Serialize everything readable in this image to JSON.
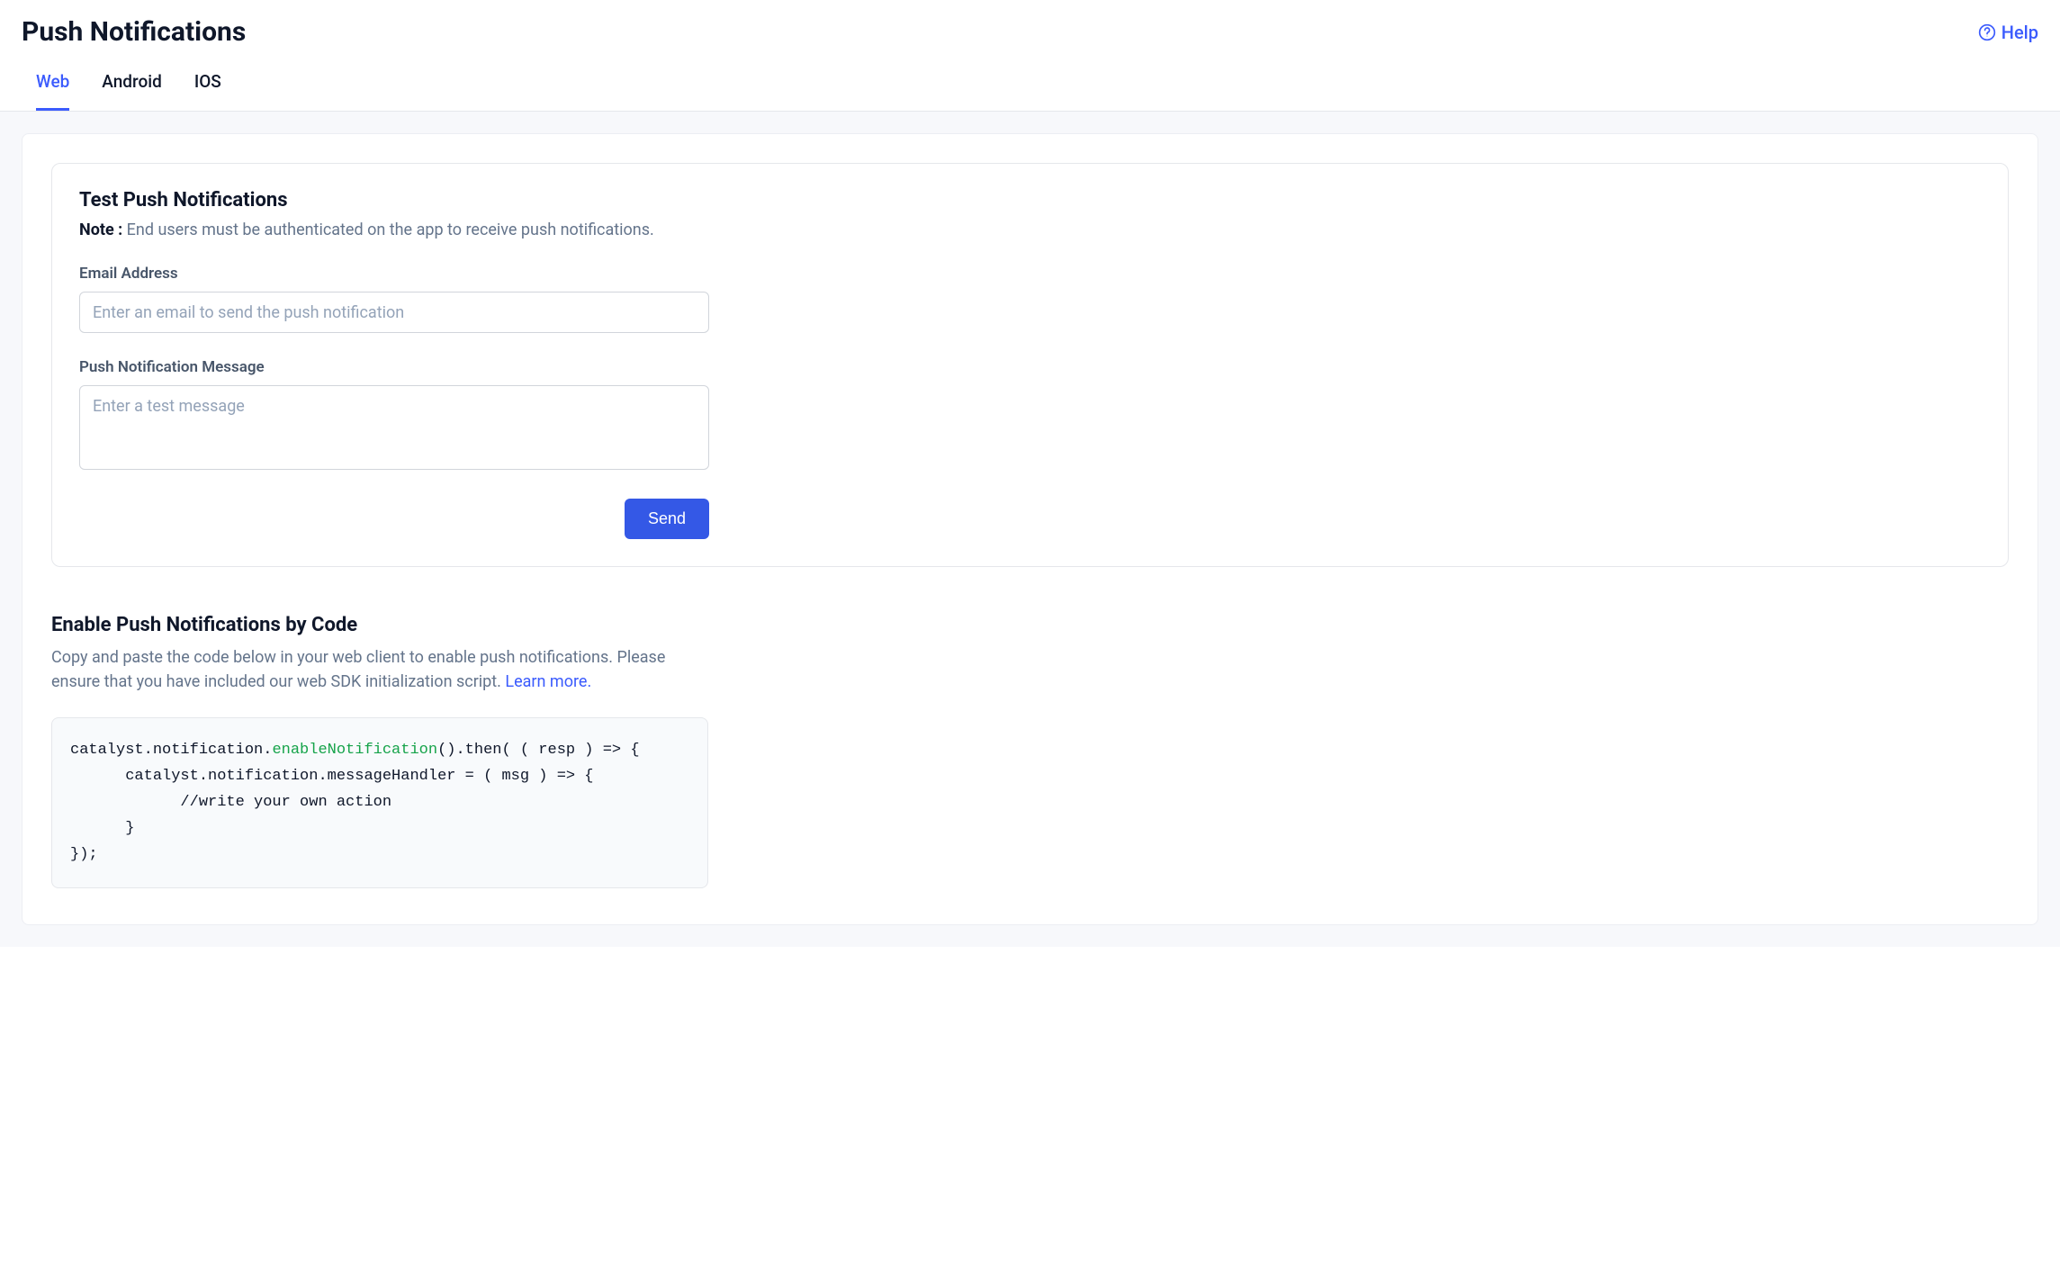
{
  "header": {
    "title": "Push Notifications",
    "help_label": "Help"
  },
  "tabs": [
    {
      "label": "Web",
      "active": true
    },
    {
      "label": "Android",
      "active": false
    },
    {
      "label": "IOS",
      "active": false
    }
  ],
  "test_card": {
    "title": "Test Push Notifications",
    "note_prefix": "Note :",
    "note_text": " End users must be authenticated on the app to receive push notifications.",
    "email_label": "Email Address",
    "email_placeholder": "Enter an email to send the push notification",
    "message_label": "Push Notification Message",
    "message_placeholder": "Enter a test message",
    "send_label": "Send"
  },
  "enable_section": {
    "title": "Enable Push Notifications by Code",
    "description": "Copy and paste the code below in your web client to enable push notifications. Please ensure that you have included our web SDK initialization script. ",
    "learn_more": "Learn more.",
    "code": {
      "line1_a": "catalyst.notification.",
      "line1_fn": "enableNotification",
      "line1_b": "().then( ( resp ) => {",
      "line2": "      catalyst.notification.messageHandler = ( msg ) => {",
      "line3": "            //write your own action",
      "line4": "      }",
      "line5": "});"
    }
  }
}
